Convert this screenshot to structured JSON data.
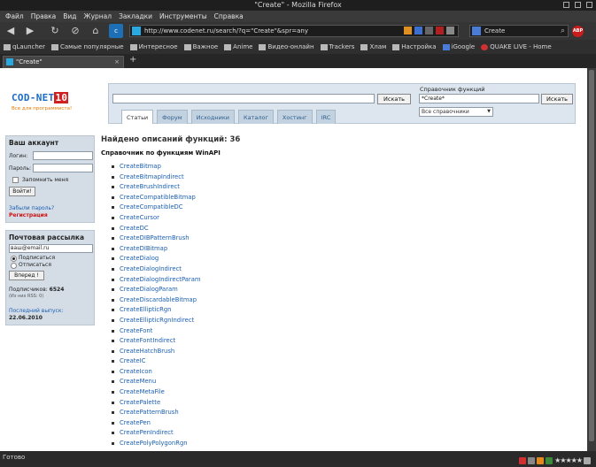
{
  "window": {
    "title": "\"Create\" - Mozilla Firefox"
  },
  "menu": [
    "Файл",
    "Правка",
    "Вид",
    "Журнал",
    "Закладки",
    "Инструменты",
    "Справка"
  ],
  "nav": {
    "url": "http://www.codenet.ru/search/?q=\"Create\"&spr=any",
    "search_value": "Create",
    "abp_label": "ABP"
  },
  "bookmarks": [
    "qLauncher",
    "Самые популярные",
    "Интересное",
    "Важное",
    "Anime",
    "Видео-онлайн",
    "Trackers",
    "Хлам",
    "Настройка",
    "iGoogle",
    "QUAKE LIVE - Home"
  ],
  "tab": {
    "title": "\"Create\""
  },
  "site": {
    "logo_text": "COD-NET",
    "logo_num": "10",
    "logo_sub": "Все для программиста!",
    "search": {
      "button": "Искать",
      "func_label": "Справочник функций",
      "func_value": "*Create*",
      "func_button": "Искать",
      "select_value": "Все справочники",
      "tabs": [
        "Статьи",
        "Форум",
        "Исходники",
        "Каталог",
        "Хостинг",
        "IRC"
      ]
    },
    "account": {
      "title": "Ваш аккаунт",
      "login_label": "Логин:",
      "password_label": "Пароль:",
      "remember": "Запомнить меня",
      "submit": "Войти!",
      "forgot": "Забыли пароль?",
      "register": "Регистрация"
    },
    "mailing": {
      "title": "Почтовая рассылка",
      "email": "ваш@email.ru",
      "subscribe": "Подписаться",
      "unsubscribe": "Отписаться",
      "submit": "Вперед !",
      "subscribers_label": "Подписчиков:",
      "subscribers": "6524",
      "rss_note": "(Из них RSS: 0)",
      "last_label": "Последний выпуск:",
      "last_date": "22.06.2010"
    },
    "main": {
      "found": "Найдено описаний функций: 36",
      "subhead": "Справочник по функциям WinAPI",
      "functions": [
        "CreateBitmap",
        "CreateBitmapIndirect",
        "CreateBrushIndirect",
        "CreateCompatibleBitmap",
        "CreateCompatibleDC",
        "CreateCursor",
        "CreateDC",
        "CreateDIBPatternBrush",
        "CreateDIBitmap",
        "CreateDialog",
        "CreateDialogIndirect",
        "CreateDialogIndirectParam",
        "CreateDialogParam",
        "CreateDiscardableBitmap",
        "CreateEllipticRgn",
        "CreateEllipticRgnIndirect",
        "CreateFont",
        "CreateFontIndirect",
        "CreateHatchBrush",
        "CreateIC",
        "CreateIcon",
        "CreateMenu",
        "CreateMetaFile",
        "CreatePalette",
        "CreatePatternBrush",
        "CreatePen",
        "CreatePenIndirect",
        "CreatePolyPolygonRgn"
      ]
    }
  },
  "status": {
    "text": "Готово",
    "stars": "★★★★★"
  },
  "colors": {
    "accent": "#1a5fb4",
    "panel": "#d4dde6",
    "logo_red": "#d02020"
  }
}
